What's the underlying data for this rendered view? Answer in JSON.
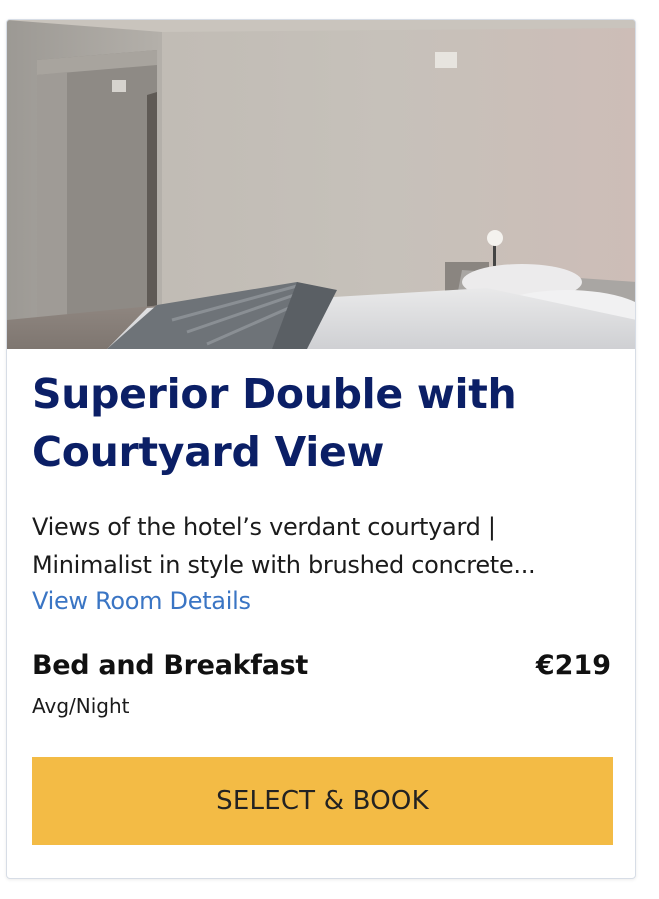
{
  "room": {
    "title_line1": "Superior Double with",
    "title_line2": "Courtyard View",
    "description_line1": "Views of the hotel’s verdant courtyard |",
    "description_line2": "Minimalist in style with brushed concrete...",
    "details_link": "View Room Details",
    "rate_name": "Bed and Breakfast",
    "price": "€219",
    "price_note": "Avg/Night",
    "book_label": "SELECT & BOOK"
  },
  "colors": {
    "title": "#0b1f66",
    "link": "#3a75c4",
    "button": "#f3bb45"
  }
}
